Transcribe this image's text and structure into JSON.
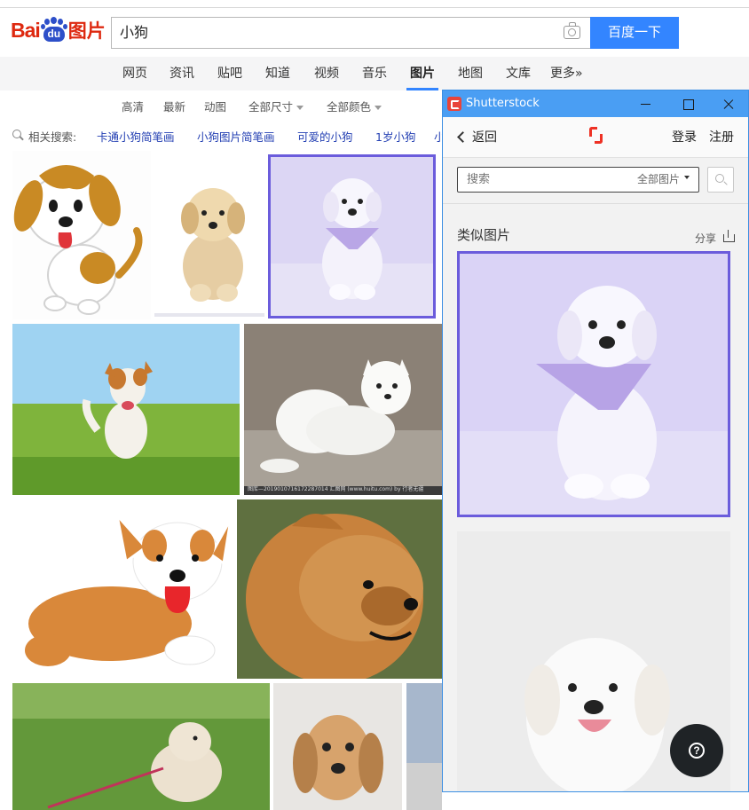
{
  "header": {
    "logo": {
      "bai": "Bai",
      "du": "du",
      "tu": "图片"
    },
    "search": {
      "value": "小狗"
    },
    "search_button_label": "百度一下"
  },
  "nav": {
    "items": [
      {
        "label": "网页"
      },
      {
        "label": "资讯"
      },
      {
        "label": "贴吧"
      },
      {
        "label": "知道"
      },
      {
        "label": "视频"
      },
      {
        "label": "音乐"
      },
      {
        "label": "图片",
        "active": true
      },
      {
        "label": "地图"
      },
      {
        "label": "文库"
      },
      {
        "label": "更多»"
      }
    ]
  },
  "filters": {
    "items": [
      {
        "label": "高清"
      },
      {
        "label": "最新"
      },
      {
        "label": "动图"
      },
      {
        "label": "全部尺寸"
      },
      {
        "label": "全部颜色"
      }
    ]
  },
  "related": {
    "label": "相关搜索:",
    "links": [
      "卡通小狗简笔画",
      "小狗图片简笔画",
      "可爱的小狗",
      "1岁小狗",
      "小"
    ]
  },
  "results": {
    "selected_index": 2,
    "tiles": [
      {
        "icon": "cartoon-beagle"
      },
      {
        "icon": "golden-puppy"
      },
      {
        "icon": "white-puppy-bandana"
      },
      {
        "icon": "running-puppy"
      },
      {
        "icon": "white-spitz"
      },
      {
        "icon": "cartoon-corgi"
      },
      {
        "icon": "pomeranian"
      },
      {
        "icon": "puppy-on-grass"
      },
      {
        "icon": "dachshund-puppy"
      },
      {
        "icon": "partial-image"
      }
    ],
    "caption": "图库—2019010716172287014 汇图网 (www.huitu.com) by 行者无疆"
  },
  "popup": {
    "window_title": "Shutterstock",
    "back_label": "返回",
    "login_label": "登录",
    "register_label": "注册",
    "search_placeholder": "搜索",
    "filter_label": "全部图片",
    "similar_heading": "类似图片",
    "share_label": "分享"
  },
  "colors": {
    "accent_blue": "#3385ff",
    "titlebar_blue": "#4a9ef3",
    "selection_purple": "#6b5cdc",
    "logo_red": "#de2910",
    "shutterstock_red": "#ee3124"
  }
}
